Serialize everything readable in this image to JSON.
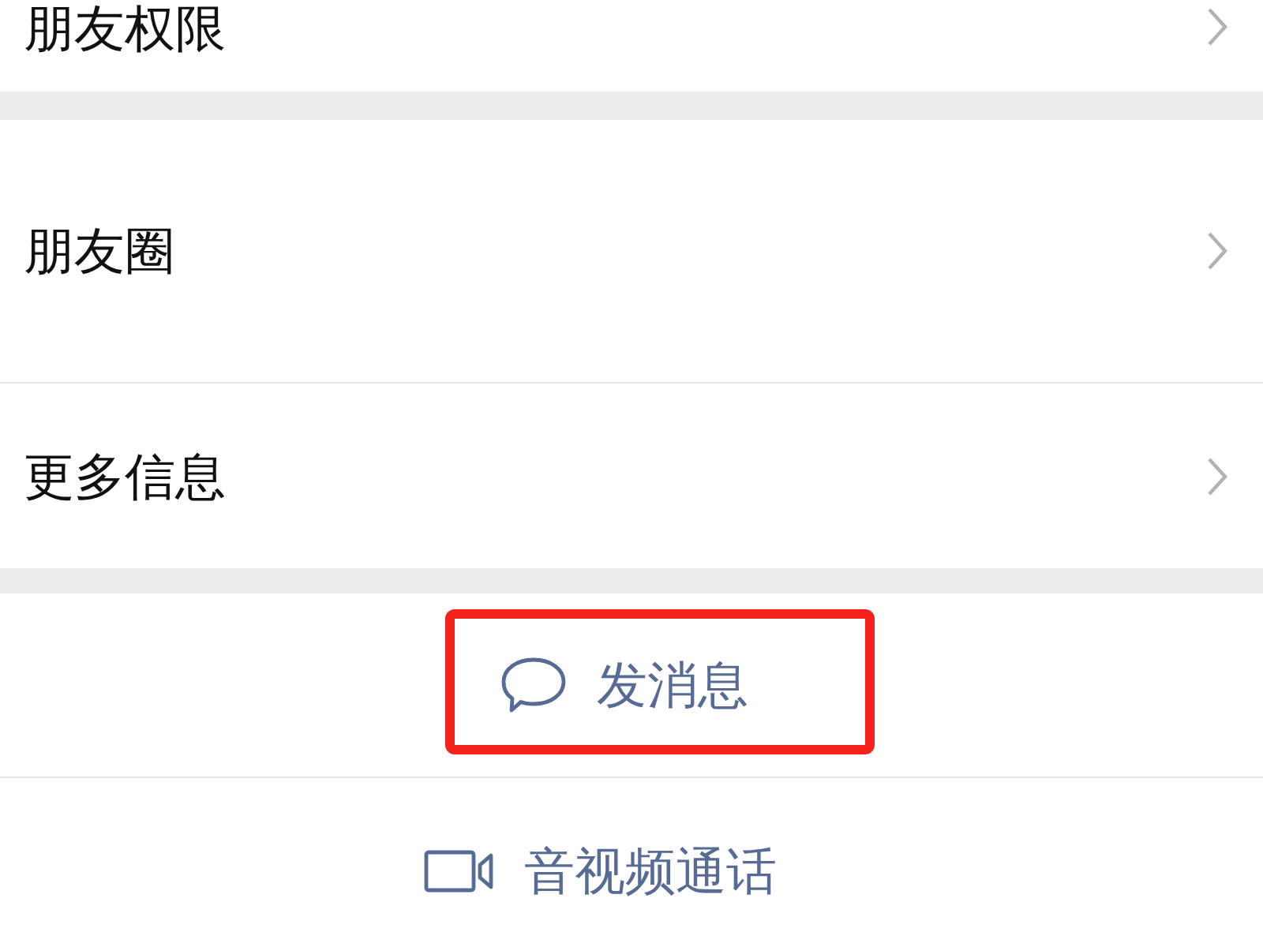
{
  "top_row": {
    "label": "朋友权限"
  },
  "info_rows": [
    {
      "label": "朋友圈"
    },
    {
      "label": "更多信息"
    }
  ],
  "actions": [
    {
      "kind": "message",
      "label": "发消息",
      "highlighted": true
    },
    {
      "kind": "call",
      "label": "音视频通话",
      "highlighted": false
    }
  ]
}
